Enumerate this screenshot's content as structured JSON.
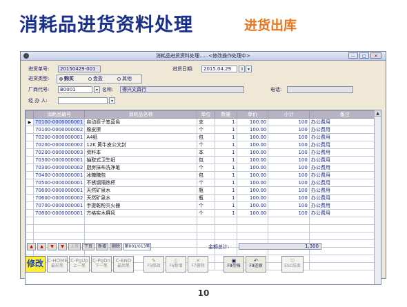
{
  "slide": {
    "title": "消耗品进货资料处理",
    "subtitle": "进货出库",
    "page_number": "10"
  },
  "window": {
    "title": "消耗品进货资料处理......<修改操作处理中>",
    "min": "—",
    "max": "□",
    "close": "✕"
  },
  "form": {
    "order_no_label": "进货单号:",
    "order_no": "20150429-001",
    "date_label": "进货日期:",
    "date": "2015.04.29",
    "type_label": "进货类型:",
    "type_options": [
      "购买",
      "盘盈",
      "其他"
    ],
    "type_selected": "购买",
    "vendor_code_label": "厂商代号:",
    "vendor_code": "B0001",
    "vendor_name_label": "名称:",
    "vendor_name": "得兴文具行",
    "phone_label": "电话:",
    "phone": "",
    "handler_label": "经 办 人:",
    "handler": ""
  },
  "grid": {
    "columns": [
      "消耗品编号",
      "消耗品名称",
      "单位",
      "数量",
      "单价",
      "小计",
      "备注"
    ],
    "rows": [
      {
        "code": "70100-0000000001",
        "name": "自动原子笔蓝色",
        "unit": "支",
        "qty": "1",
        "price": "100.00",
        "subtotal": "100",
        "note": "办公费用"
      },
      {
        "code": "70100-0000000002",
        "name": "橡皮擦",
        "unit": "个",
        "qty": "1",
        "price": "100.00",
        "subtotal": "100",
        "note": "办公费用"
      },
      {
        "code": "70200-0000000001",
        "name": "A4纸",
        "unit": "包",
        "qty": "1",
        "price": "100.00",
        "subtotal": "100",
        "note": "办公费用"
      },
      {
        "code": "70200-0000000002",
        "name": "12K 黄牛皮公文封",
        "unit": "个",
        "qty": "1",
        "price": "100.00",
        "subtotal": "100",
        "note": "办公费用"
      },
      {
        "code": "70200-0000000003",
        "name": "资料本",
        "unit": "本",
        "qty": "1",
        "price": "100.00",
        "subtotal": "100",
        "note": "办公费用"
      },
      {
        "code": "70300-0000000001",
        "name": "抽取式卫生纸",
        "unit": "包",
        "qty": "1",
        "price": "100.00",
        "subtotal": "100",
        "note": "办公费用"
      },
      {
        "code": "70300-0000000002",
        "name": "厨房抹布洗净笔",
        "unit": "个",
        "qty": "1",
        "price": "100.00",
        "subtotal": "100",
        "note": "办公费用"
      },
      {
        "code": "70400-0000000001",
        "name": "冰糖糖包",
        "unit": "包",
        "qty": "1",
        "price": "100.00",
        "subtotal": "100",
        "note": "办公费用"
      },
      {
        "code": "70500-0000000001",
        "name": "不锈钢隔热杯",
        "unit": "个",
        "qty": "1",
        "price": "100.00",
        "subtotal": "100",
        "note": "办公费用"
      },
      {
        "code": "70600-0000000001",
        "name": "天然矿泉水",
        "unit": "瓶",
        "qty": "1",
        "price": "100.00",
        "subtotal": "100",
        "note": "办公费用"
      },
      {
        "code": "70600-0000000002",
        "name": "天然矿泉水",
        "unit": "瓶",
        "qty": "1",
        "price": "100.00",
        "subtotal": "100",
        "note": "办公费用"
      },
      {
        "code": "70700-0000000001",
        "name": "手提乾粉灭火器",
        "unit": "个",
        "qty": "1",
        "price": "100.00",
        "subtotal": "100",
        "note": "办公费用"
      },
      {
        "code": "70800-0000000001",
        "name": "方格实木屏风",
        "unit": "个",
        "qty": "1",
        "price": "100.00",
        "subtotal": "100",
        "note": "办公费用"
      }
    ]
  },
  "nav": {
    "first": "▲",
    "prev": "▲",
    "next": "▼",
    "last": "▼",
    "page_up": "上页",
    "page_down": "下页",
    "add_row": "新增",
    "delete_row": "删除",
    "record": "第001/013笔",
    "total_label": "金额总计:",
    "total": "1,300"
  },
  "toolbar": {
    "edit": "修改",
    "first": [
      "C-HOME",
      "最前笔"
    ],
    "prev": [
      "C-PgUp",
      "上一笔"
    ],
    "next": [
      "C-PgDn",
      "下一笔"
    ],
    "last": [
      "C-END",
      "最后笔"
    ],
    "modify": [
      "F5修改"
    ],
    "new": [
      "F6新增"
    ],
    "delete": [
      "F7删除"
    ],
    "save": [
      "F8存档"
    ],
    "restore": [
      "F9还原"
    ],
    "exit": [
      "ESC结束"
    ]
  }
}
